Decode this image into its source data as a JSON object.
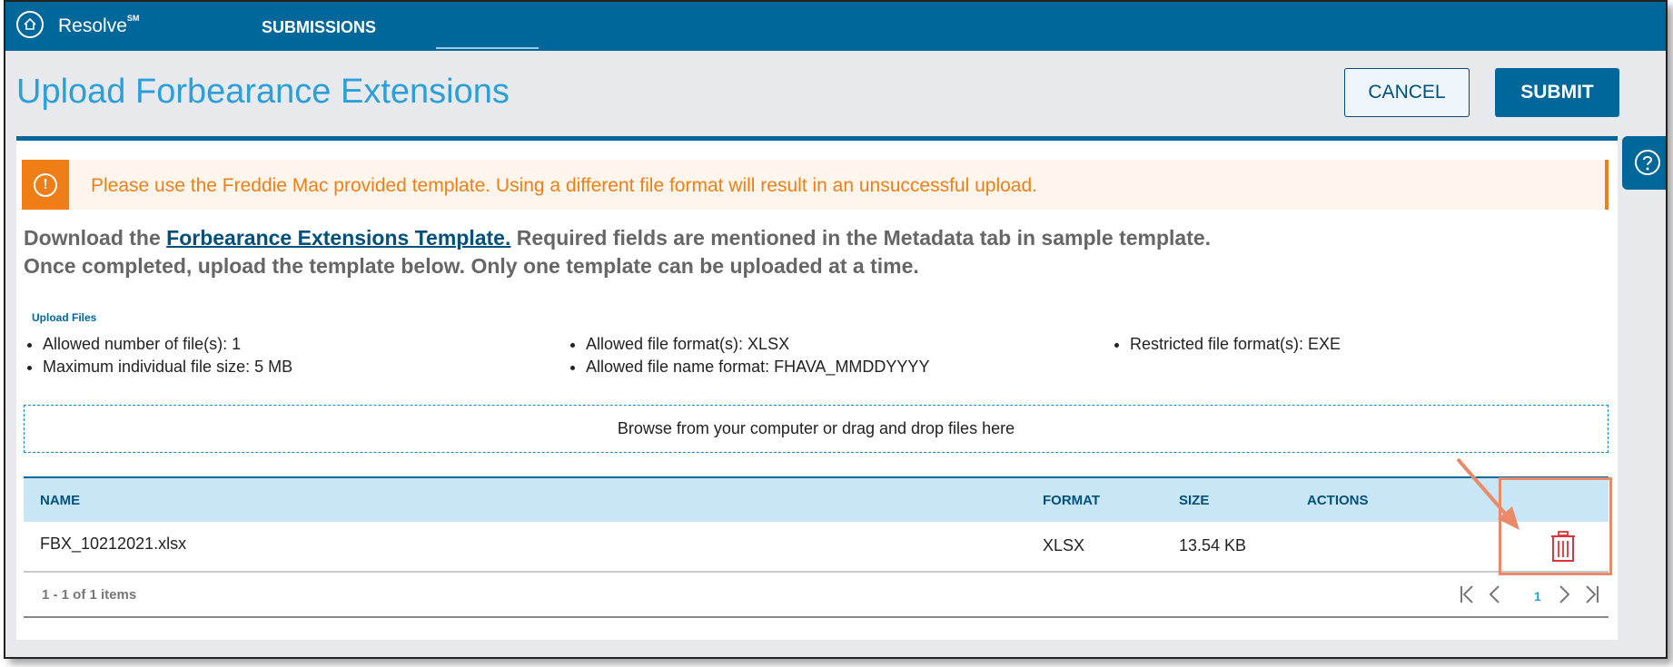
{
  "app": {
    "brand": "Resolve",
    "brand_mark": "SM"
  },
  "nav": {
    "submissions": "SUBMISSIONS"
  },
  "page": {
    "title": "Upload Forbearance Extensions"
  },
  "actions": {
    "cancel": "CANCEL",
    "submit": "SUBMIT"
  },
  "alert": {
    "text": "Please use the Freddie Mac provided template. Using a different file format will result in an unsuccessful upload."
  },
  "instructions": {
    "line1_prefix": "Download the ",
    "template_link": "Forbearance Extensions Template.",
    "line1_suffix": " Required fields are mentioned in the Metadata tab in sample template.",
    "line2": "Once completed, upload the template below. Only one template can be uploaded at a time."
  },
  "upload": {
    "label": "Upload Files",
    "requirements": [
      "Allowed number of file(s): 1",
      "Maximum individual file size: 5 MB",
      "Allowed file format(s): XLSX",
      "Allowed file name format: FHAVA_MMDDYYYY",
      "Restricted file format(s): EXE"
    ],
    "dropzone": "Browse from your computer or drag and drop files here"
  },
  "table": {
    "columns": {
      "name": "NAME",
      "format": "FORMAT",
      "size": "SIZE",
      "actions": "ACTIONS"
    },
    "rows": [
      {
        "name": "FBX_10212021.xlsx",
        "format": "XLSX",
        "size": "13.54 KB"
      }
    ]
  },
  "pagination": {
    "info": "1 - 1 of 1 items",
    "current_page": "1"
  },
  "icons": [
    "logo-icon",
    "help-icon",
    "alert-icon",
    "trash-icon",
    "first-page-icon",
    "prev-page-icon",
    "next-page-icon",
    "last-page-icon"
  ],
  "colors": {
    "primary": "#00679a",
    "accent_blue": "#2b9fd9",
    "warning": "#f07e17",
    "delete": "#e0303a",
    "annotation": "#e98a6a"
  }
}
